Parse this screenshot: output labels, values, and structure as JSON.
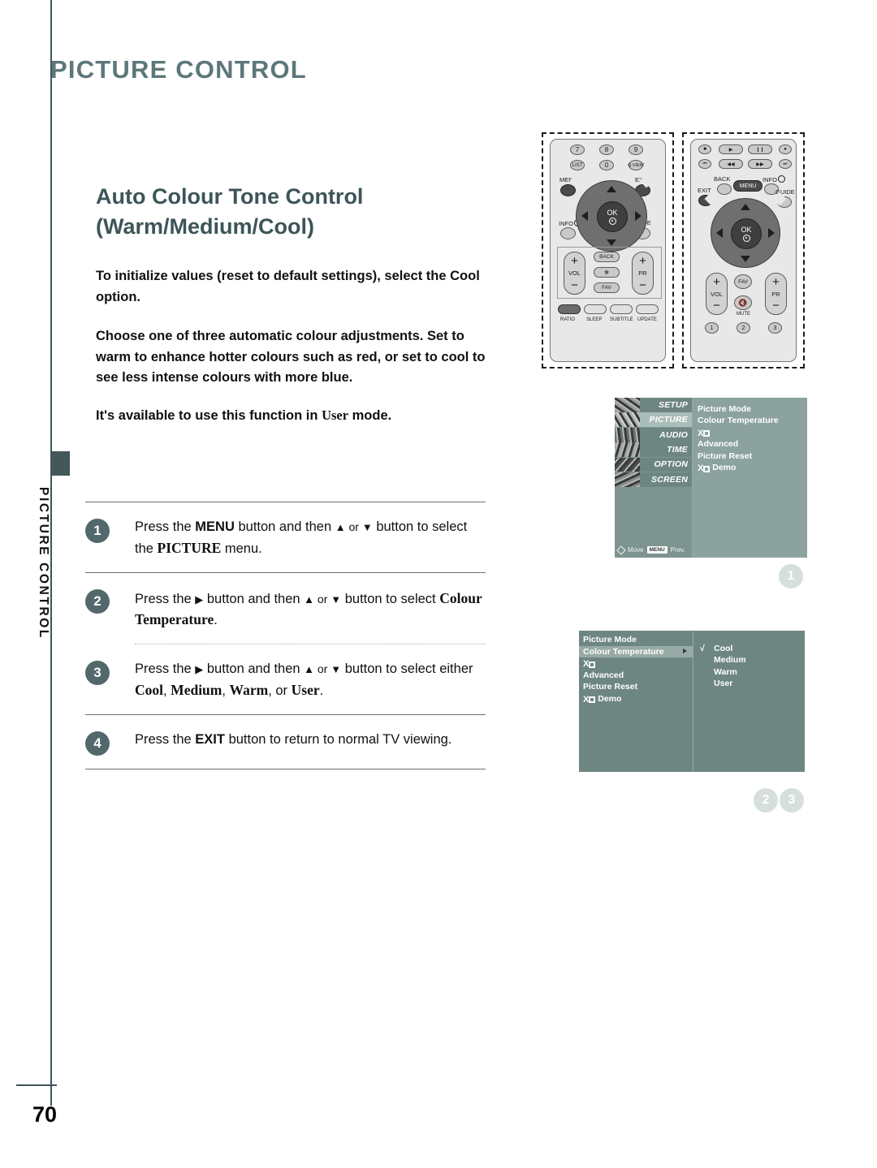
{
  "page": {
    "header_title": "PICTURE CONTROL",
    "sidebar_vertical_label": "PICTURE CONTROL",
    "page_number": "70"
  },
  "article": {
    "heading_line1": "Auto Colour Tone Control",
    "heading_line2": "(Warm/Medium/Cool)",
    "paragraph_1": "To initialize values (reset to default settings), select the Cool option.",
    "paragraph_2": "Choose one of three automatic colour adjustments. Set to warm to enhance hotter colours such as red, or set to cool to see less intense colours with more blue.",
    "paragraph_3_pre": "It's available to use this function in ",
    "paragraph_3_bold": "User",
    "paragraph_3_post": " mode."
  },
  "steps": [
    {
      "number": "1",
      "pre": "Press the ",
      "b1": "MENU",
      "mid1": " button and then ",
      "up": "▲",
      "or": " or ",
      "down": "▼",
      "mid2": " button to select the ",
      "b2": "PICTURE",
      "post": " menu."
    },
    {
      "number": "2",
      "pre": "Press the ",
      "b1": "▶",
      "mid1": " button and then ",
      "up": "▲",
      "or": " or ",
      "down": "▼",
      "mid2": " button to select ",
      "b2": "Colour Temperature",
      "post": "."
    },
    {
      "number": "3",
      "pre": "Press the ",
      "b1": "▶",
      "mid1": " button and then ",
      "up": "▲",
      "or": " or ",
      "down": "▼",
      "mid2": " button to select either ",
      "b2": "Cool",
      "sep1": ", ",
      "b3": "Medium",
      "sep2": ", ",
      "b4": "Warm",
      "sep3": ", or ",
      "b5": "User",
      "post": "."
    },
    {
      "number": "4",
      "pre": "Press the ",
      "b1": "EXIT",
      "post": " button to return to normal TV viewing."
    }
  ],
  "remote_left": {
    "numbers_row1": [
      "7",
      "8",
      "9"
    ],
    "numbers_row2": [
      "LIST",
      "0",
      "Q.VIEW"
    ],
    "menu_label": "MENU",
    "exit_label": "EXIT",
    "info_label": "INFO",
    "guide_label": "GUIDE",
    "ok_label": "OK",
    "vol_label": "VOL",
    "pr_label": "PR",
    "plus": "+",
    "minus": "−",
    "back_label": "BACK",
    "star_label": "✻",
    "fav_label": "FAV",
    "bottom_buttons": [
      "RATIO",
      "SLEEP",
      "SUBTITLE",
      "UPDATE"
    ]
  },
  "remote_right": {
    "transport_row1": [
      "■",
      "▶",
      "❙❙",
      "●"
    ],
    "transport_row2": [
      "⏮",
      "◀◀",
      "▶▶",
      "⏭"
    ],
    "back_label": "BACK",
    "menu_label": "MENU",
    "info_label": "INFO",
    "exit_label": "EXIT",
    "guide_label": "GUIDE",
    "ok_label": "OK",
    "vol_label": "VOL",
    "pr_label": "PR",
    "plus": "+",
    "minus": "−",
    "fav_label": "FAV",
    "mute_label": "MUTE",
    "bottom_numbers": [
      "1",
      "2",
      "3"
    ]
  },
  "osd_main": {
    "menu_tabs": [
      {
        "label": "SETUP",
        "active": false
      },
      {
        "label": "PICTURE",
        "active": true
      },
      {
        "label": "AUDIO",
        "active": false
      },
      {
        "label": "TIME",
        "active": false
      },
      {
        "label": "OPTION",
        "active": false
      },
      {
        "label": "SCREEN",
        "active": false
      }
    ],
    "items": [
      {
        "label": "Picture Mode",
        "xd_prefix": false
      },
      {
        "label": "Colour Temperature",
        "xd_prefix": false
      },
      {
        "label": "",
        "xd_prefix": true
      },
      {
        "label": "Advanced",
        "xd_prefix": false
      },
      {
        "label": "Picture Reset",
        "xd_prefix": false
      },
      {
        "label": "Demo",
        "xd_prefix": true
      }
    ],
    "footer_move": "Move",
    "footer_key": "MENU",
    "footer_prev": "Prev."
  },
  "osd_submenu": {
    "items": [
      {
        "label": "Picture Mode",
        "xd_prefix": false,
        "highlighted": false,
        "caret": false
      },
      {
        "label": "Colour Temperature",
        "xd_prefix": false,
        "highlighted": true,
        "caret": true
      },
      {
        "label": "",
        "xd_prefix": true,
        "highlighted": false,
        "caret": false
      },
      {
        "label": "Advanced",
        "xd_prefix": false,
        "highlighted": false,
        "caret": false
      },
      {
        "label": "Picture Reset",
        "xd_prefix": false,
        "highlighted": false,
        "caret": false
      },
      {
        "label": "Demo",
        "xd_prefix": true,
        "highlighted": false,
        "caret": false
      }
    ],
    "options": [
      {
        "label": "Cool",
        "checked": true
      },
      {
        "label": "Medium",
        "checked": false
      },
      {
        "label": "Warm",
        "checked": false
      },
      {
        "label": "User",
        "checked": false
      }
    ],
    "check_glyph": "√"
  },
  "callouts": {
    "one": "1",
    "two": "2",
    "three": "3"
  },
  "colors": {
    "heading": "#3d5558",
    "page_title": "#5c777a",
    "step_badge": "#52686b",
    "osd_bg": "#7d9490",
    "osd_panel": "#8ba29e",
    "osd_highlight": "#a9bdb9",
    "callout": "#d6dfdb"
  }
}
